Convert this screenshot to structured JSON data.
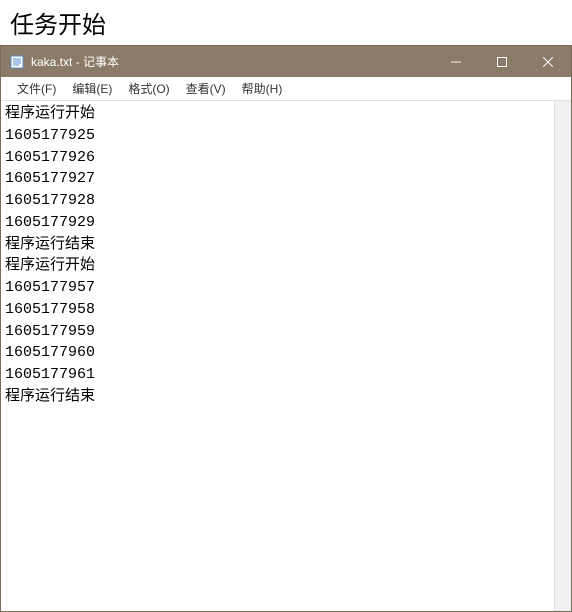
{
  "page": {
    "heading": "任务开始"
  },
  "window": {
    "title": "kaka.txt - 记事本"
  },
  "menubar": {
    "items": [
      {
        "label": "文件(F)"
      },
      {
        "label": "编辑(E)"
      },
      {
        "label": "格式(O)"
      },
      {
        "label": "查看(V)"
      },
      {
        "label": "帮助(H)"
      }
    ]
  },
  "content": {
    "lines": [
      "程序运行开始",
      "1605177925",
      "1605177926",
      "1605177927",
      "1605177928",
      "1605177929",
      "程序运行结束",
      "程序运行开始",
      "1605177957",
      "1605177958",
      "1605177959",
      "1605177960",
      "1605177961",
      "程序运行结束"
    ]
  }
}
